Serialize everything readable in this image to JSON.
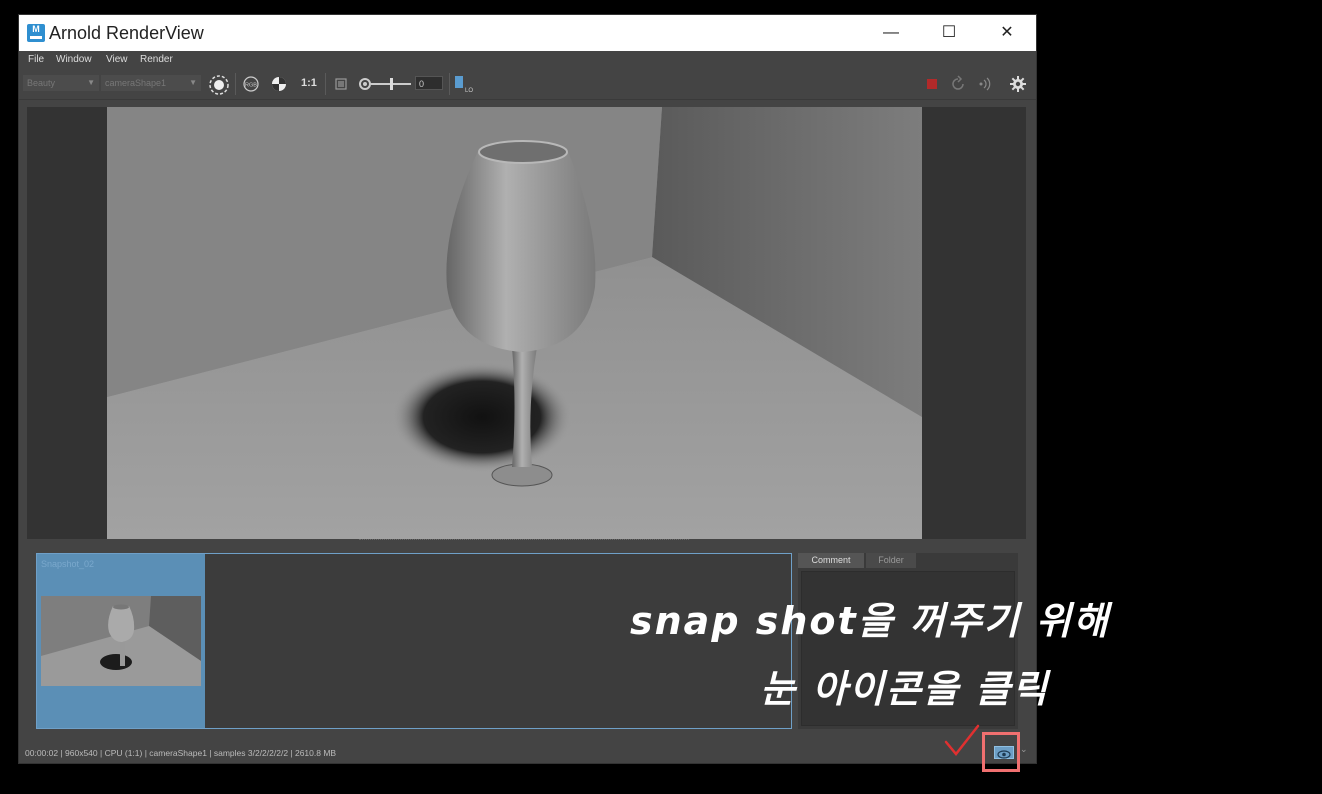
{
  "window": {
    "app_icon_letter": "M",
    "title": "Arnold RenderView",
    "minimize_glyph": "—",
    "maximize_glyph": "☐",
    "close_glyph": "✕"
  },
  "menu": [
    "File",
    "Window",
    "View",
    "Render"
  ],
  "toolbar": {
    "aov_select": "Beauty",
    "camera_select": "cameraShape1",
    "ratio_label": "1:1",
    "exposure_value": "0",
    "icons": [
      "region-icon",
      "rgb-icon",
      "channel-icon",
      "crop-icon",
      "exposure-icon",
      "log-icon",
      "stop-icon",
      "refresh-icon",
      "ipr-icon",
      "gear-icon"
    ]
  },
  "snapshots": {
    "items": [
      {
        "label": "Snapshot_02"
      }
    ]
  },
  "side_tabs": {
    "comment": "Comment",
    "folder": "Folder"
  },
  "status": {
    "text": "00:00:02 | 960x540 | CPU (1:1) | cameraShape1 | samples 3/2/2/2/2/2 | 2610.8 MB"
  },
  "annotation": {
    "line1": "snap shot을 꺼주기 위해",
    "line2": "눈 아이콘을 클릭"
  },
  "colors": {
    "accent": "#6d9fc6",
    "highlight": "#f07070",
    "stop": "#b22a2a"
  }
}
